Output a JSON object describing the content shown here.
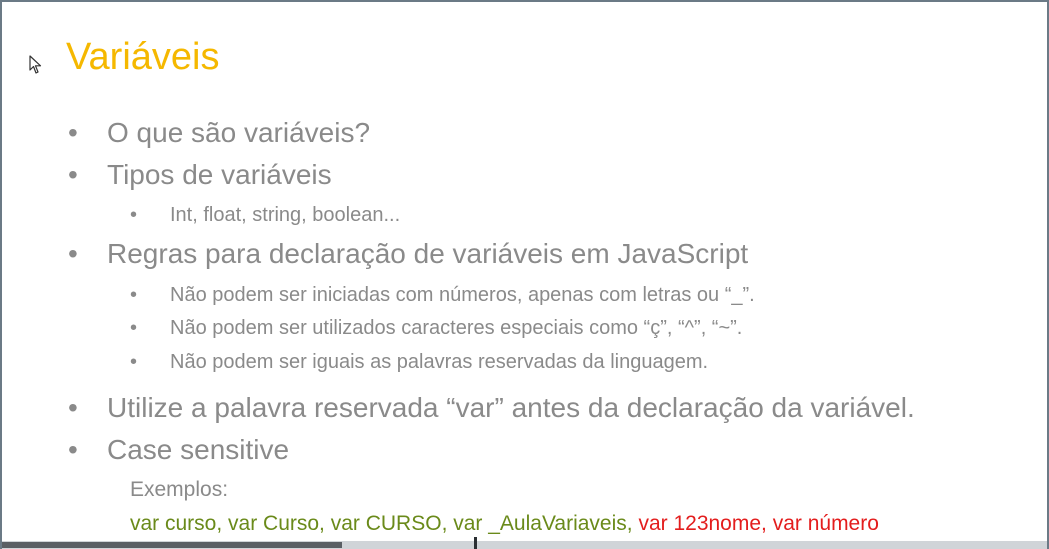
{
  "slide": {
    "title": "Variáveis",
    "bullets": [
      "O que são variáveis?",
      "Tipos de variáveis",
      "Regras para declaração de variáveis em JavaScript",
      "Utilize a palavra reservada “var” antes da declaração da variável.",
      "Case sensitive"
    ],
    "sub_types": [
      "Int, float, string, boolean..."
    ],
    "sub_rules": [
      "Não podem ser iniciadas com números, apenas com letras ou “_”.",
      "Não podem ser utilizados caracteres especiais como “ç”, “^”, “~”.",
      "Não podem ser iguais as palavras reservadas da linguagem."
    ],
    "examples_label": "Exemplos:",
    "examples_valid": "var curso, var Curso, var CURSO, var _AulaVariaveis,",
    "examples_invalid": "var 123nome, var número",
    "bullet_char": "•"
  },
  "colors": {
    "title": "#f5b800",
    "text": "#8a8a8a",
    "valid_example": "#6a8a1a",
    "invalid_example": "#e31d1d"
  },
  "icons": [
    "mouse-cursor-icon"
  ],
  "video_progress": 0.325
}
